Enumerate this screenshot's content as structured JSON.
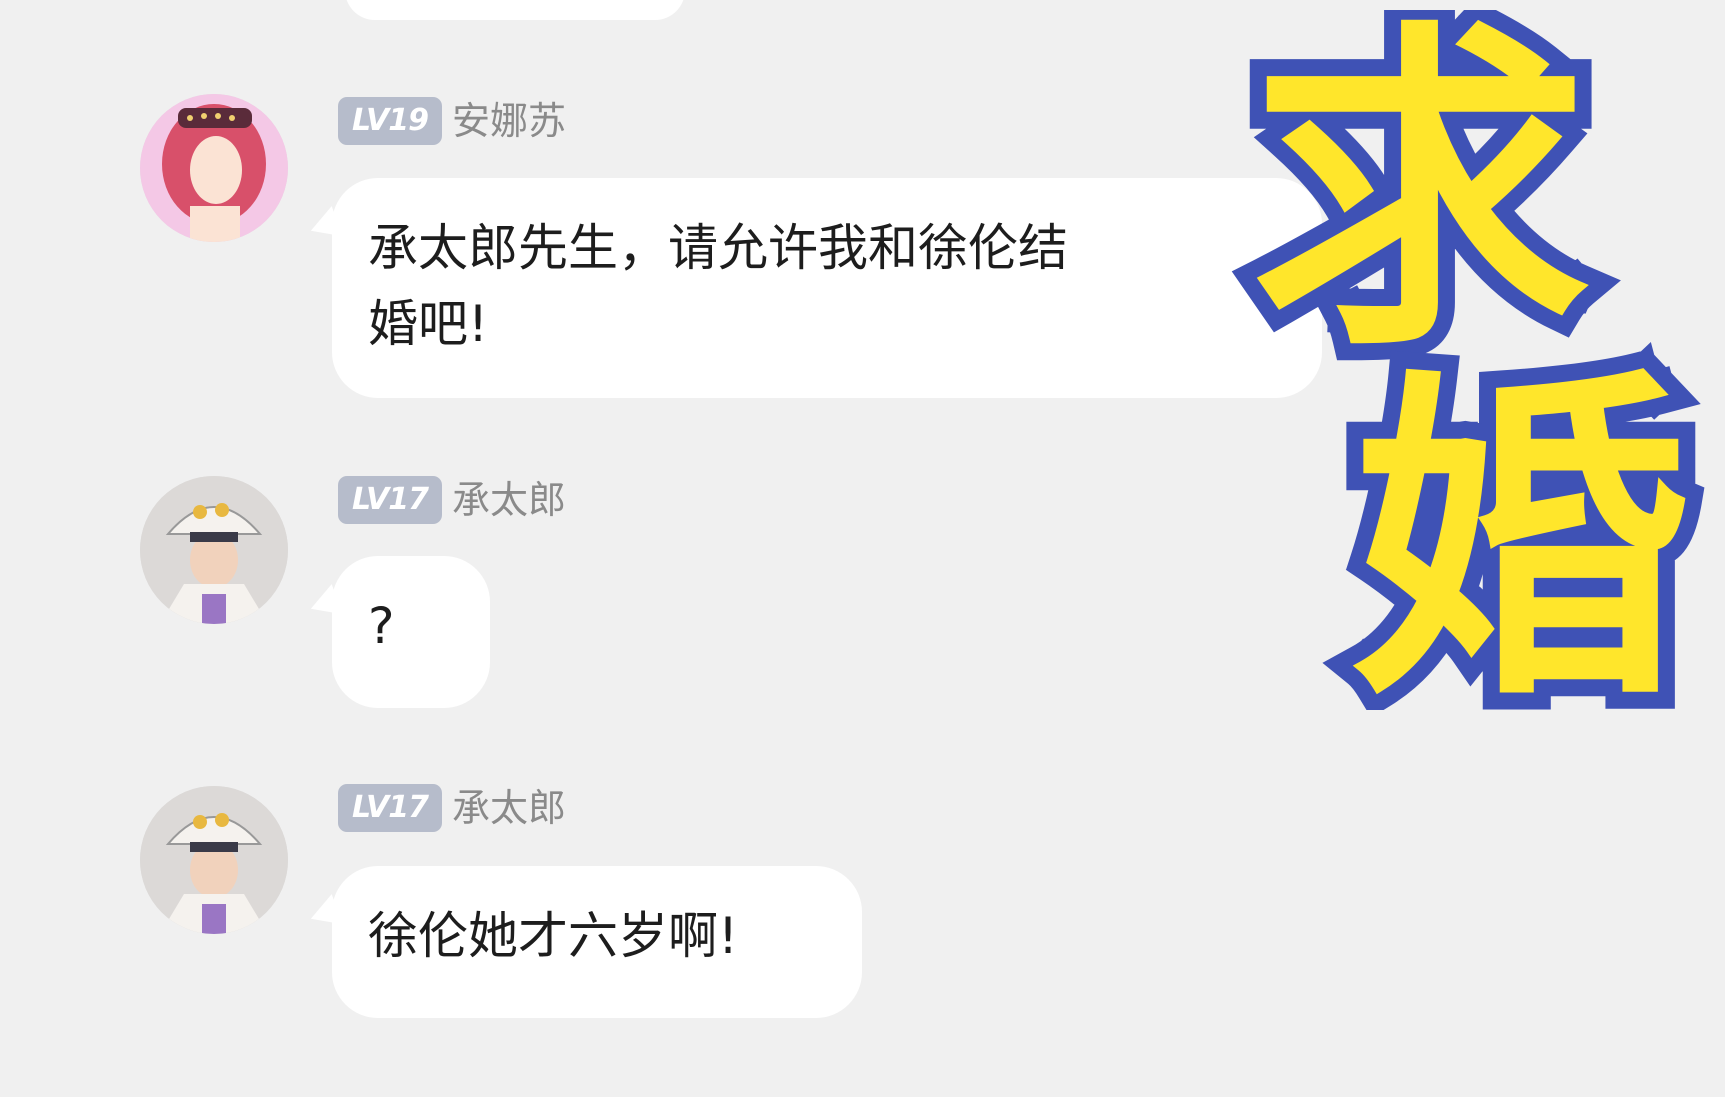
{
  "messages": [
    {
      "level": "LV19",
      "name": "安娜苏",
      "avatar_icon": "pink-hair-character-avatar",
      "lines": [
        "承太郎先生，请允许我和徐伦结",
        "婚吧!"
      ]
    },
    {
      "level": "LV17",
      "name": "承太郎",
      "avatar_icon": "white-cap-character-avatar",
      "lines": [
        "?"
      ]
    },
    {
      "level": "LV17",
      "name": "承太郎",
      "avatar_icon": "white-cap-character-avatar",
      "lines": [
        "徐伦她才六岁啊!"
      ]
    }
  ],
  "overlay_title": {
    "char1": "求",
    "char2": "婚",
    "fill_color": "#ffe62b",
    "outline_color": "#3f52b5"
  },
  "colors": {
    "background": "#f0f0f0",
    "bubble": "#ffffff",
    "level_badge": "#b6bccb",
    "name_text": "#8a8a8a"
  }
}
